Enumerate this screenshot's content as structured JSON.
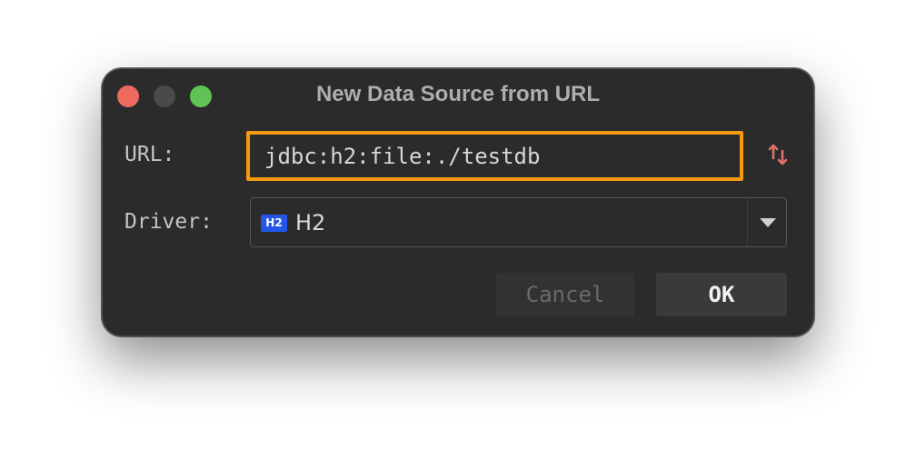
{
  "window": {
    "title": "New Data Source from URL"
  },
  "form": {
    "url_label": "URL:",
    "url_value": "jdbc:h2:file:./testdb",
    "driver_label": "Driver:",
    "driver_value": "H2",
    "driver_icon_text": "H2",
    "driver_icon": "h2-database-icon",
    "swap_icon": "swap-vertical-arrows-icon"
  },
  "buttons": {
    "cancel_label": "Cancel",
    "ok_label": "OK"
  },
  "colors": {
    "dialog_background": "#2b2b2b",
    "url_field_highlight": "#f59a0e",
    "traffic_close": "#ed6a5e",
    "traffic_minimize": "#4a4a4a",
    "traffic_maximize": "#5fc453",
    "driver_icon_background": "#2457e8",
    "swap_icon_color": "#e0706a"
  }
}
